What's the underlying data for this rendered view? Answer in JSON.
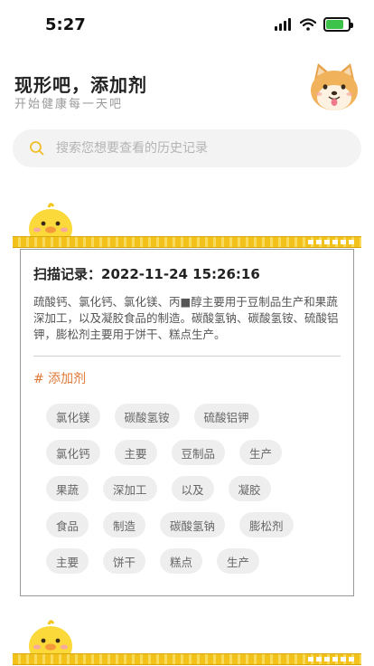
{
  "status": {
    "time": "5:27",
    "battery_level": 0.8,
    "battery_color": "#3dc24a"
  },
  "header": {
    "title": "现形吧，添加剂",
    "subtitle": "开始健康每一天吧"
  },
  "search": {
    "placeholder": "搜索您想要查看的历史记录",
    "value": "",
    "icon": "search-icon",
    "icon_color": "#f2bd2a"
  },
  "record": {
    "scan_label": "扫描记录：",
    "timestamp": "2022-11-24 15:26:16",
    "description": "疏酸钙、氯化钙、氯化镁、丙■醇主要用于豆制品生产和果蔬深加工，以及凝胶食品的制造。碳酸氢钠、碳酸氢铵、硫酸铝钾，膨松剂主要用于饼干、糕点生产。",
    "section_title": "# 添加剂",
    "section_color": "#e07a3a",
    "tag_rows": [
      [
        "氯化镁",
        "碳酸氢铵",
        "硫酸铝钾"
      ],
      [
        "氯化钙",
        "主要",
        "豆制品",
        "生产"
      ],
      [
        "果蔬",
        "深加工",
        "以及",
        "凝胶"
      ],
      [
        "食品",
        "制造",
        "碳酸氢钠",
        "膨松剂"
      ],
      [
        "主要",
        "饼干",
        "糕点",
        "生产"
      ]
    ]
  },
  "colors": {
    "accent": "#f3c21a",
    "tag_bg": "#eeeeee"
  }
}
